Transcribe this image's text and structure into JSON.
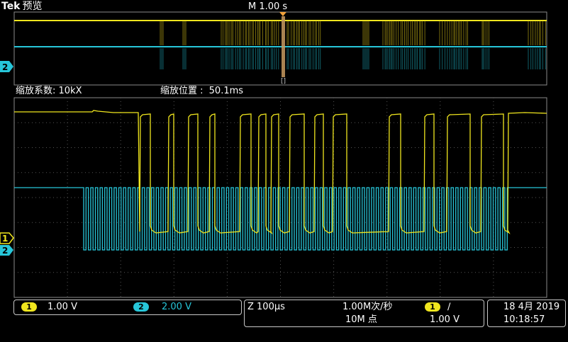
{
  "header": {
    "brand": "Tek",
    "mode": "预览",
    "timebase": "M 1.00 s"
  },
  "zoom_info": {
    "factor_label": "缩放系数: 10kX",
    "position_label": "缩放位置 :",
    "position_value": "50.1ms"
  },
  "markers": {
    "ch1": "1",
    "ch2": "2",
    "ch2_top": "2"
  },
  "status": {
    "ch1_num": "1",
    "ch1_scale": "1.00 V",
    "ch2_num": "2",
    "ch2_scale": "2.00 V",
    "zoom_scale": "Z 100µs",
    "sample_rate": "1.00M次/秒",
    "record_length": "10M 点",
    "trigger_ch": "1",
    "trigger_slope": "∕",
    "trigger_level": "1.00 V",
    "date": "18 4月 2019",
    "time": "10:18:57"
  },
  "colors": {
    "ch1": "#f0e61e",
    "ch2": "#27c6d9",
    "grid": "#555555",
    "trigger": "#f2a23a"
  }
}
